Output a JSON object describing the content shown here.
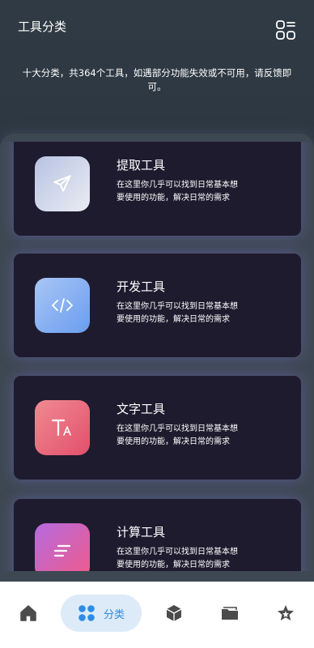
{
  "header": {
    "title": "工具分类",
    "menu_icon": "grid-icon"
  },
  "intro": {
    "text": "十大分类，共364个工具，如遇部分功能失效或不可用，请反馈即可。"
  },
  "categories": [
    {
      "name": "提取工具",
      "desc": "在这里你几乎可以找到日常基本想要使用的功能，解决日常的需求",
      "icon": "send-icon"
    },
    {
      "name": "开发工具",
      "desc": "在这里你几乎可以找到日常基本想要使用的功能，解决日常的需求",
      "icon": "code-icon"
    },
    {
      "name": "文字工具",
      "desc": "在这里你几乎可以找到日常基本想要使用的功能，解决日常的需求",
      "icon": "text-size-icon"
    },
    {
      "name": "计算工具",
      "desc": "在这里你几乎可以找到日常基本想要使用的功能，解决日常的需求",
      "icon": "lines-icon"
    }
  ],
  "tabbar": {
    "tabs": [
      {
        "icon": "home-icon"
      },
      {
        "icon": "apps-icon",
        "label": "分类",
        "active": true
      },
      {
        "icon": "cube-icon"
      },
      {
        "icon": "folder-icon"
      },
      {
        "icon": "star-icon"
      }
    ]
  },
  "colors": {
    "accent": "#2f8be6",
    "card_bg": "#1f1b2e",
    "tab_active_bg": "#dcebf7"
  }
}
